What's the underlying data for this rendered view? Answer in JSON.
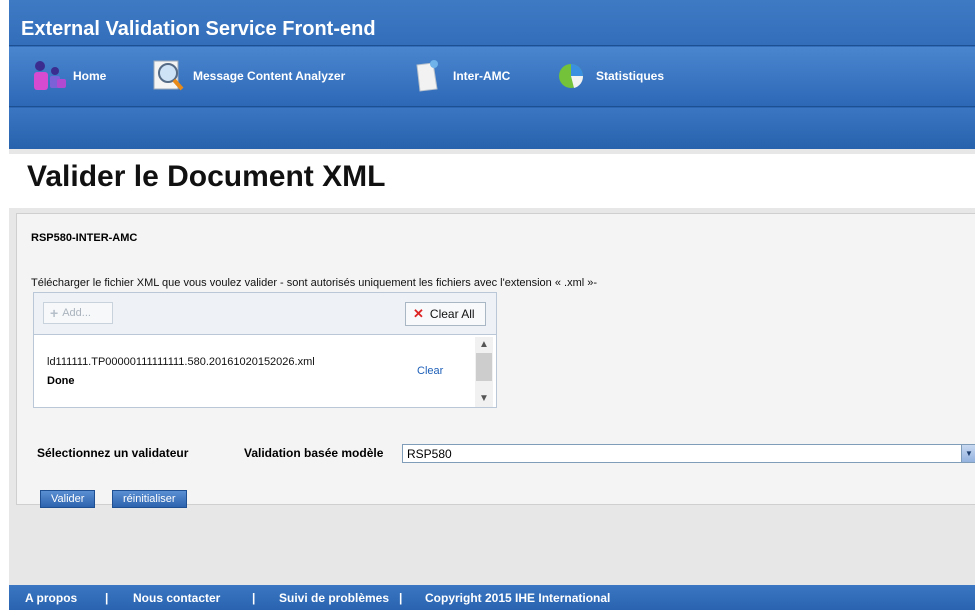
{
  "header": {
    "title": "External Validation Service Front-end"
  },
  "nav": {
    "items": [
      {
        "label": "Home",
        "icon": "home-people-icon"
      },
      {
        "label": "Message Content Analyzer",
        "icon": "magnifier-document-icon"
      },
      {
        "label": "Inter-AMC",
        "icon": "document-icon"
      },
      {
        "label": "Statistiques",
        "icon": "pie-chart-icon"
      }
    ]
  },
  "main": {
    "page_title": "Valider le Document XML",
    "section_title": "RSP580-INTER-AMC",
    "upload": {
      "instructions": "Télécharger le fichier XML que vous voulez valider - sont autorisés uniquement les fichiers avec l'extension « .xml »-",
      "add_label": "Add...",
      "clear_all_label": "Clear All",
      "file_name": "ld111111.TP00000111111111.580.20161020152026.xml",
      "file_status": "Done",
      "file_clear_label": "Clear"
    },
    "validator_label": "Sélectionnez un validateur",
    "model_label": "Validation basée modèle",
    "model_value": "RSP580",
    "validate_button": "Valider",
    "reset_button": "réinitialiser"
  },
  "footer": {
    "about": "A propos",
    "contact": "Nous contacter",
    "issues": "Suivi de problèmes",
    "copyright": "Copyright 2015 IHE International",
    "separator": "|"
  }
}
